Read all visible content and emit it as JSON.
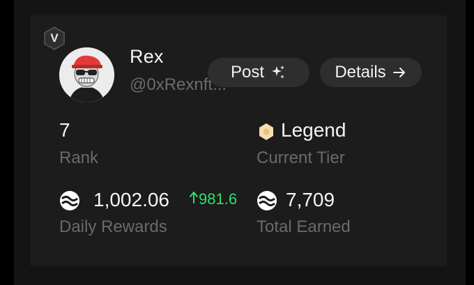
{
  "profile": {
    "badge_letter": "V",
    "name": "Rex",
    "handle": "@0xRexnft..."
  },
  "actions": {
    "post_label": "Post",
    "post_icon": "sparkles-icon",
    "details_label": "Details",
    "details_icon": "arrow-right-icon"
  },
  "stats": {
    "rank_value": "7",
    "rank_label": "Rank",
    "tier_value": "Legend",
    "tier_label": "Current Tier",
    "tier_icon": "hexagon-icon",
    "daily_value": "1,002.06",
    "daily_delta": "981.6",
    "daily_label": "Daily Rewards",
    "total_value": "7,709",
    "total_label": "Total Earned"
  },
  "colors": {
    "card_bg": "#1c1c1c",
    "delta_green": "#2fe06a",
    "tier_gold": "#f5deb0",
    "avatar_cap_red": "#e23a3a"
  }
}
